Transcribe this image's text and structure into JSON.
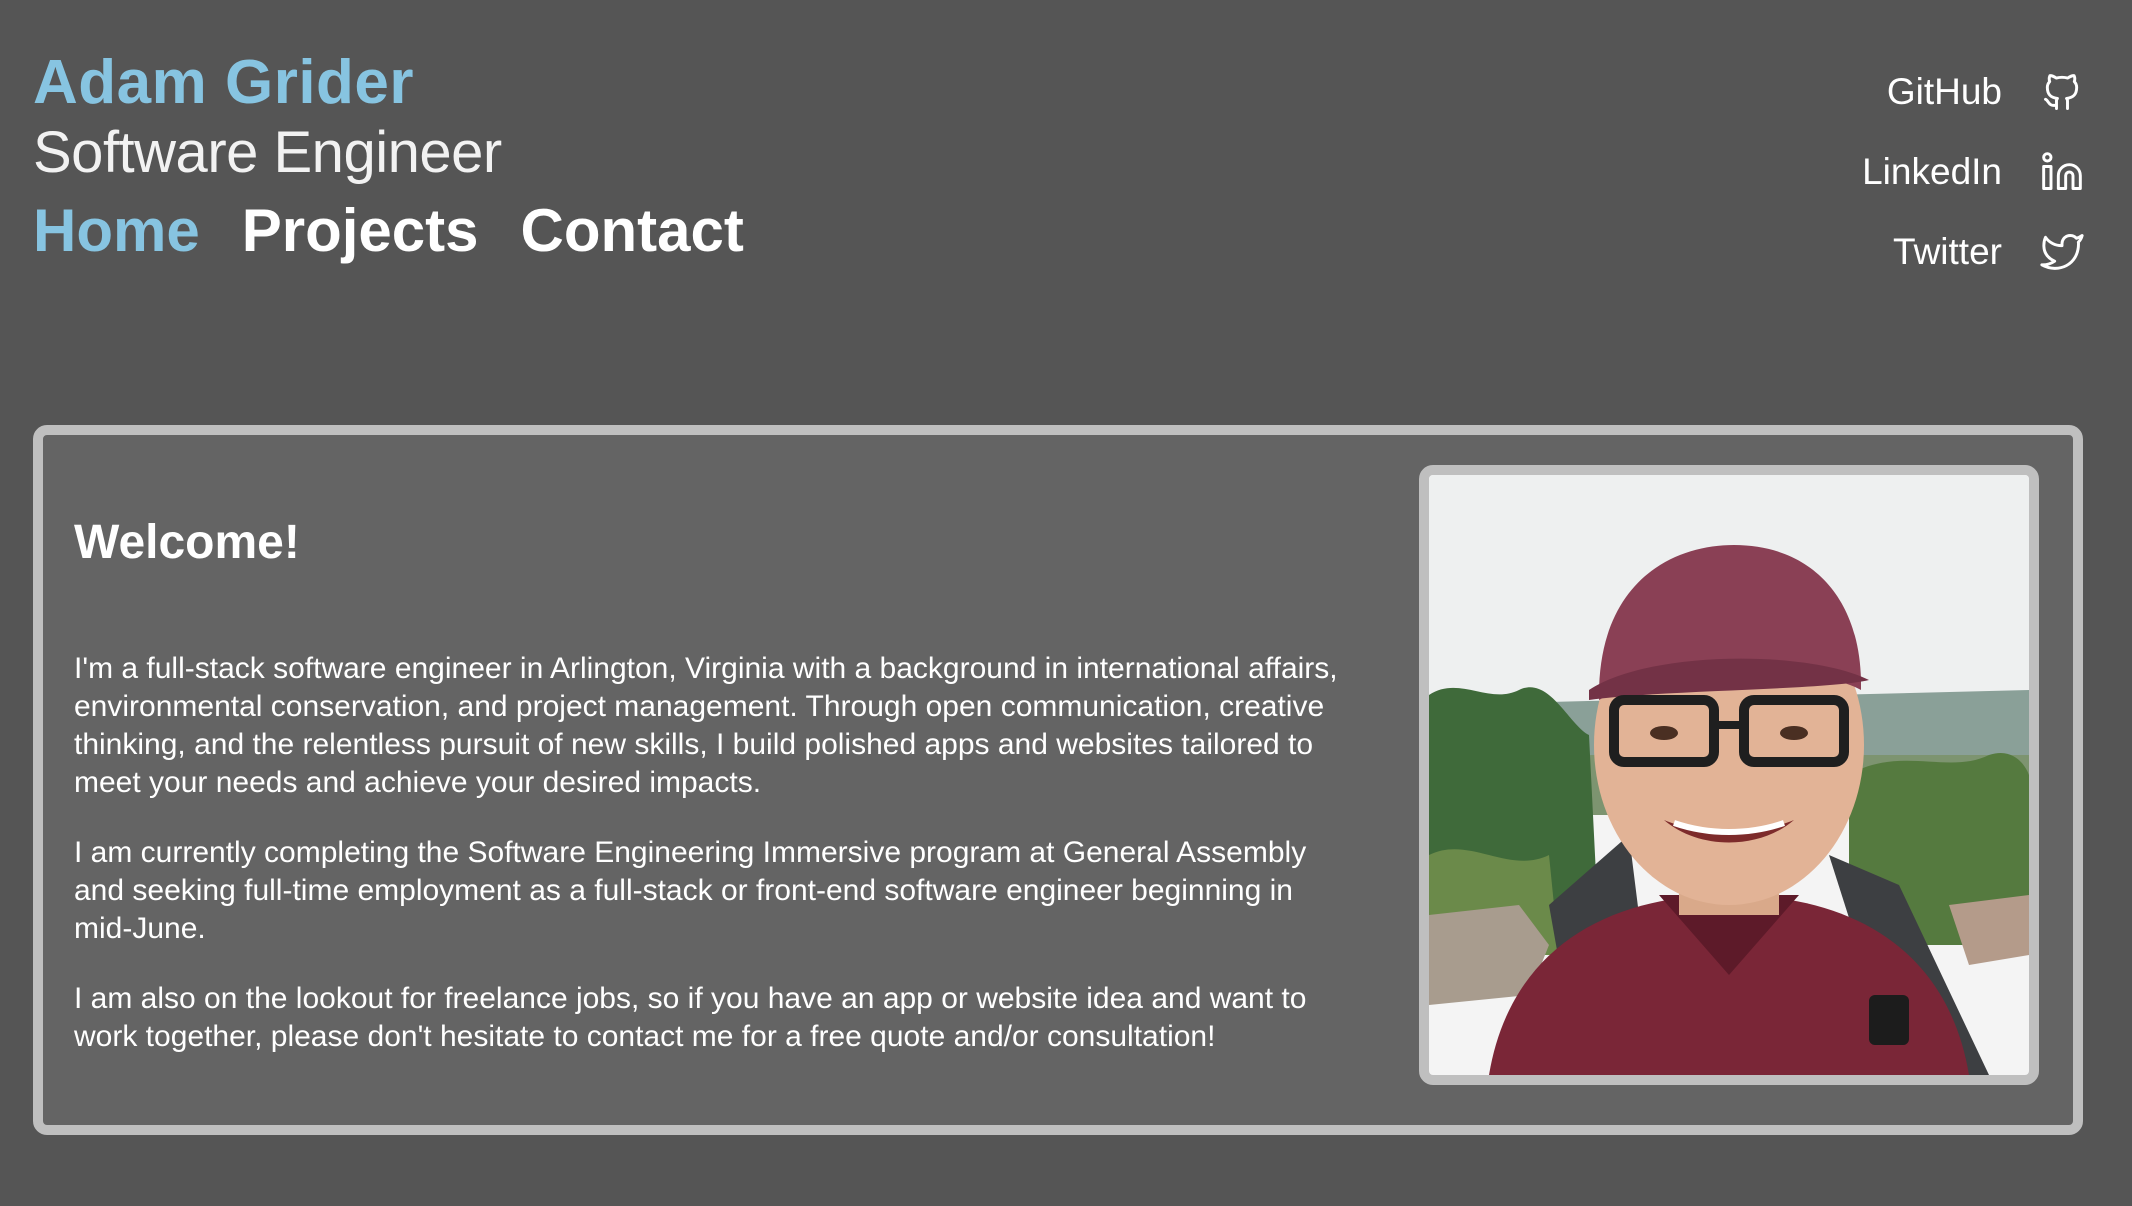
{
  "header": {
    "name": "Adam Grider",
    "role": "Software Engineer",
    "nav": [
      {
        "label": "Home",
        "active": true
      },
      {
        "label": "Projects",
        "active": false
      },
      {
        "label": "Contact",
        "active": false
      }
    ]
  },
  "social": [
    {
      "label": "GitHub",
      "icon": "github-icon"
    },
    {
      "label": "LinkedIn",
      "icon": "linkedin-icon"
    },
    {
      "label": "Twitter",
      "icon": "twitter-icon"
    }
  ],
  "card": {
    "heading": "Welcome!",
    "paragraphs": [
      "I'm a full-stack software engineer in Arlington, Virginia with a background in international affairs, environmental conservation, and project management. Through open communication, creative thinking, and the relentless pursuit of new skills, I build polished apps and websites tailored to meet your needs and achieve your desired impacts.",
      "I am currently completing the Software Engineering Immersive program at General Assembly and seeking full-time employment as a full-stack or front-end software engineer beginning in mid-June.",
      "I am also on the lookout for freelance jobs, so if you have an app or website idea and want to work together, please don't hesitate to contact me for a free quote and/or consultation!"
    ]
  },
  "colors": {
    "background": "#555555",
    "accent": "#87c4e1",
    "card": "#646464",
    "border": "#bfbfbf"
  }
}
